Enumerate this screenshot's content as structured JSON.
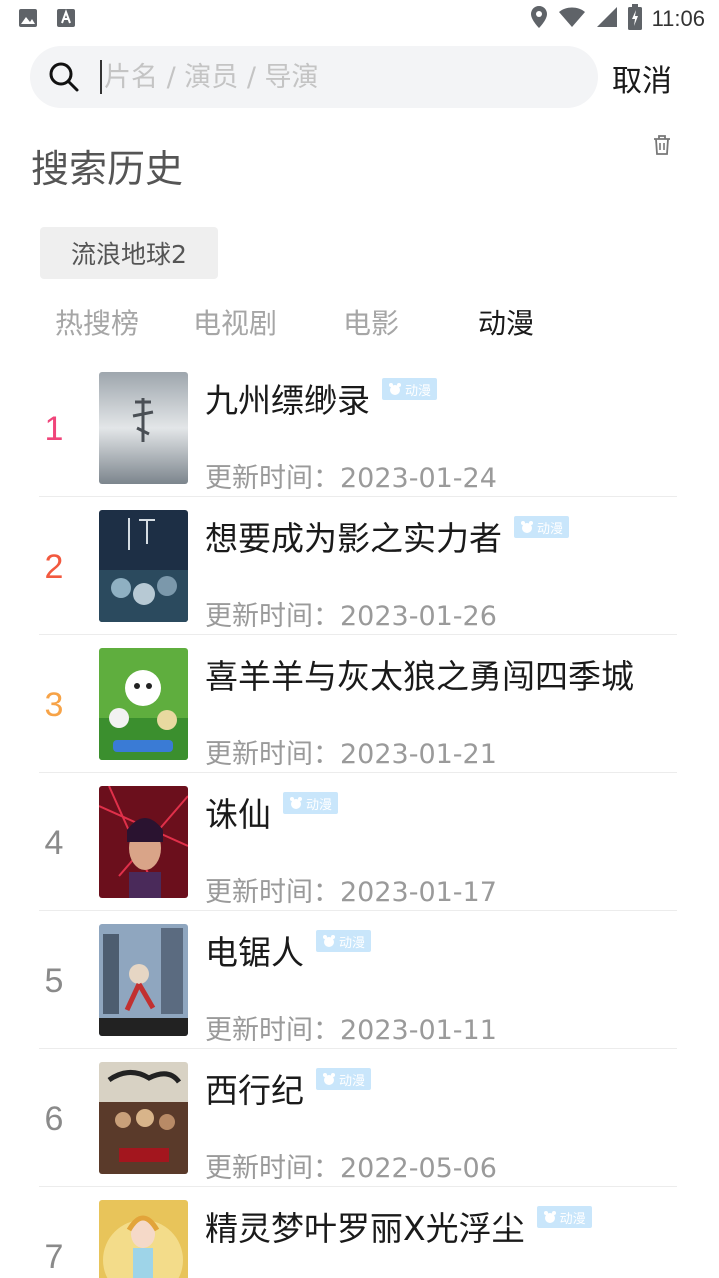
{
  "status_bar": {
    "time": "11:06"
  },
  "search": {
    "placeholder": "片名 / 演员 / 导演",
    "cancel_label": "取消"
  },
  "history": {
    "title": "搜索历史",
    "items": [
      "流浪地球2"
    ]
  },
  "tabs": [
    {
      "label": "热搜榜",
      "active": false
    },
    {
      "label": "电视剧",
      "active": false
    },
    {
      "label": "电影",
      "active": false
    },
    {
      "label": "动漫",
      "active": true
    }
  ],
  "rank_colors": [
    "#f0457a",
    "#f2593f",
    "#f7a347",
    "#8a8a8a"
  ],
  "badge_label": "动漫",
  "date_prefix": "更新时间：",
  "ranking": [
    {
      "rank": "1",
      "title": "九州缥缈录",
      "badge": true,
      "date": "2023-01-24"
    },
    {
      "rank": "2",
      "title": "想要成为影之实力者",
      "badge": true,
      "date": "2023-01-26"
    },
    {
      "rank": "3",
      "title": "喜羊羊与灰太狼之勇闯四季城",
      "badge": false,
      "date": "2023-01-21"
    },
    {
      "rank": "4",
      "title": "诛仙",
      "badge": true,
      "date": "2023-01-17"
    },
    {
      "rank": "5",
      "title": "电锯人",
      "badge": true,
      "date": "2023-01-11"
    },
    {
      "rank": "6",
      "title": "西行纪",
      "badge": true,
      "date": "2022-05-06"
    },
    {
      "rank": "7",
      "title": "精灵梦叶罗丽X光浮尘",
      "badge": true,
      "date": ""
    }
  ]
}
